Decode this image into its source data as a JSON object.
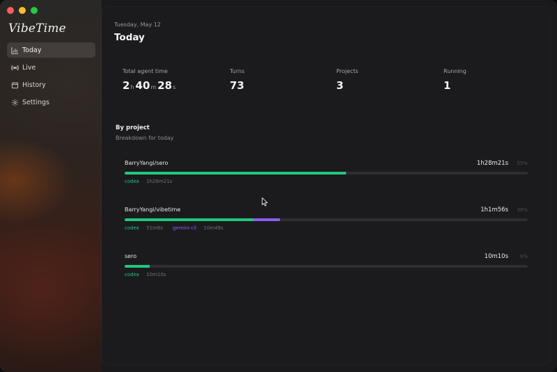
{
  "app": {
    "name": "VibeTime"
  },
  "sidebar": {
    "items": [
      {
        "label": "Today",
        "icon": "bar-chart-icon",
        "active": true
      },
      {
        "label": "Live",
        "icon": "broadcast-icon",
        "active": false
      },
      {
        "label": "History",
        "icon": "calendar-icon",
        "active": false
      },
      {
        "label": "Settings",
        "icon": "gear-icon",
        "active": false
      }
    ]
  },
  "header": {
    "date": "Tuesday, May 12",
    "title": "Today"
  },
  "stats": [
    {
      "label": "Total agent time",
      "hours": "2",
      "h_unit": "h",
      "minutes": "40",
      "m_unit": "m",
      "seconds": "28",
      "s_unit": "s"
    },
    {
      "label": "Turns",
      "value": "73"
    },
    {
      "label": "Projects",
      "value": "3"
    },
    {
      "label": "Running",
      "value": "1"
    }
  ],
  "breakdown": {
    "title": "By project",
    "subtitle": "Breakdown for today"
  },
  "projects": [
    {
      "name": "BarryYangi/sero",
      "total": "1h28m21s",
      "percent": "55%",
      "segments": [
        {
          "agent": "codex",
          "duration": "1h28m21s",
          "share": 0.55,
          "color": "#22c680"
        }
      ]
    },
    {
      "name": "BarryYangi/vibetime",
      "total": "1h1m56s",
      "percent": "38%",
      "segments": [
        {
          "agent": "codex",
          "duration": "51m6s",
          "share": 0.32,
          "color": "#22c680"
        },
        {
          "agent": "gemini-cli",
          "duration": "10m49s",
          "share": 0.065,
          "color": "#8b5cf6"
        }
      ]
    },
    {
      "name": "sero",
      "total": "10m10s",
      "percent": "6%",
      "segments": [
        {
          "agent": "codex",
          "duration": "10m10s",
          "share": 0.063,
          "color": "#22c680"
        }
      ]
    }
  ],
  "colors": {
    "accent": "#22c680",
    "gemini": "#8b5cf6"
  }
}
